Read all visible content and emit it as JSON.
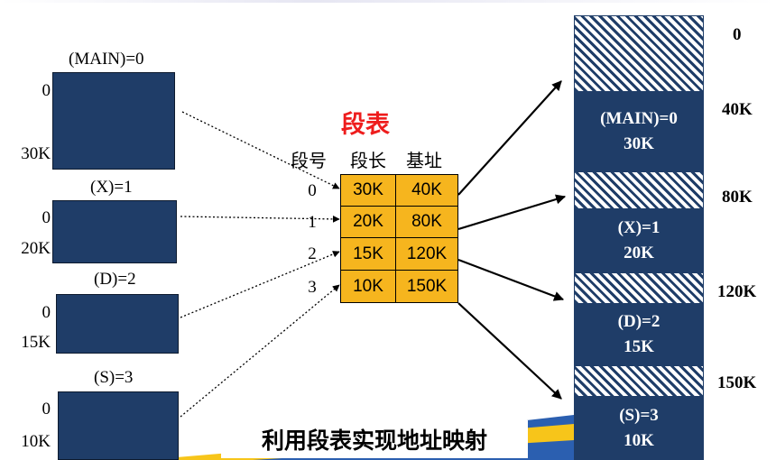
{
  "segments": [
    {
      "name": "(MAIN)=0",
      "start": "0",
      "end": "30K"
    },
    {
      "name": "(X)=1",
      "start": "0",
      "end": "20K"
    },
    {
      "name": "(D)=2",
      "start": "0",
      "end": "15K"
    },
    {
      "name": "(S)=3",
      "start": "0",
      "end": "10K"
    }
  ],
  "segment_table": {
    "title": "段表",
    "headers": {
      "no": "段号",
      "length": "段长",
      "base": "基址"
    },
    "rows": [
      {
        "no": "0",
        "length": "30K",
        "base": "40K"
      },
      {
        "no": "1",
        "length": "20K",
        "base": "80K"
      },
      {
        "no": "2",
        "length": "15K",
        "base": "120K"
      },
      {
        "no": "3",
        "length": "10K",
        "base": "150K"
      }
    ]
  },
  "memory": {
    "blocks": [
      {
        "name": "(MAIN)=0",
        "size": "30K"
      },
      {
        "name": "(X)=1",
        "size": "20K"
      },
      {
        "name": "(D)=2",
        "size": "15K"
      },
      {
        "name": "(S)=3",
        "size": "10K"
      }
    ],
    "addresses": [
      "0",
      "40K",
      "80K",
      "120K",
      "150K"
    ]
  },
  "caption": "利用段表实现地址映射",
  "colors": {
    "segment_fill": "#1f3d68",
    "table_fill": "#f6b51e",
    "title_red": "#ee1d1d",
    "banner_yellow": "#f7c51a",
    "banner_blue": "#2b5fb0"
  }
}
